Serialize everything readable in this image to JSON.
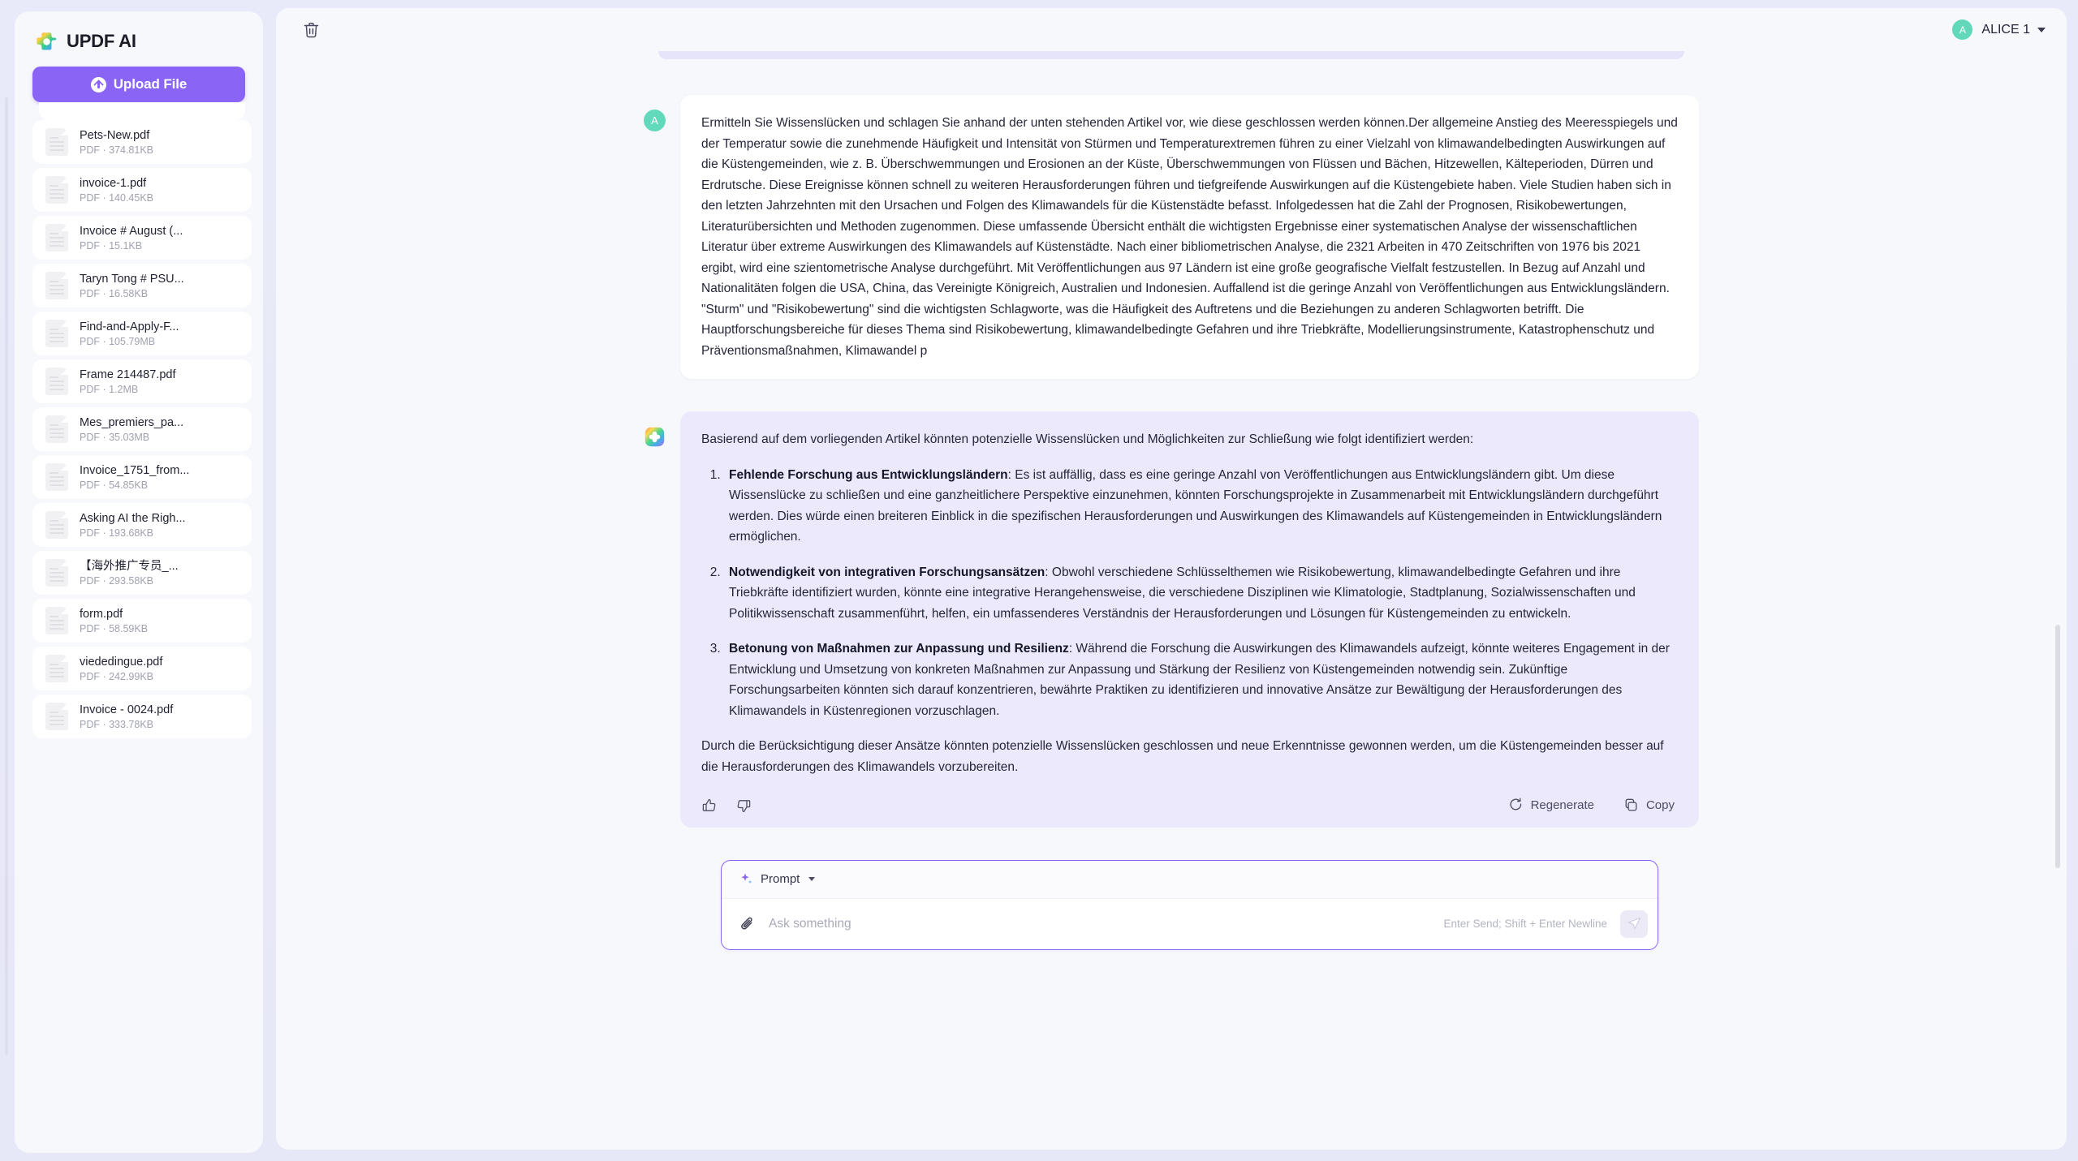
{
  "sidebar": {
    "brand": "UPDF AI",
    "upload_label": "Upload File",
    "files": [
      {
        "name": "Pets-New.pdf",
        "meta": "PDF · 374.81KB"
      },
      {
        "name": "invoice-1.pdf",
        "meta": "PDF · 140.45KB"
      },
      {
        "name": "Invoice # August (...",
        "meta": "PDF · 15.1KB"
      },
      {
        "name": "Taryn Tong # PSU...",
        "meta": "PDF · 16.58KB"
      },
      {
        "name": "Find-and-Apply-F...",
        "meta": "PDF · 105.79MB"
      },
      {
        "name": "Frame 214487.pdf",
        "meta": "PDF · 1.2MB"
      },
      {
        "name": "Mes_premiers_pa...",
        "meta": "PDF · 35.03MB"
      },
      {
        "name": "Invoice_1751_from...",
        "meta": "PDF · 54.85KB"
      },
      {
        "name": "Asking AI the Righ...",
        "meta": "PDF · 193.68KB"
      },
      {
        "name": "【海外推广专员_...",
        "meta": "PDF · 293.58KB"
      },
      {
        "name": "form.pdf",
        "meta": "PDF · 58.59KB"
      },
      {
        "name": "viededingue.pdf",
        "meta": "PDF · 242.99KB"
      },
      {
        "name": "Invoice - 0024.pdf",
        "meta": "PDF · 333.78KB"
      }
    ]
  },
  "topbar": {
    "delete_icon": "trash-icon",
    "user_name": "ALICE 1",
    "avatar_initial": "A"
  },
  "chat": {
    "user_message": {
      "avatar_initial": "A",
      "text": "Ermitteln Sie Wissenslücken und schlagen Sie anhand der unten stehenden Artikel vor, wie diese geschlossen werden können.Der allgemeine Anstieg des Meeresspiegels und der Temperatur sowie die zunehmende Häufigkeit und Intensität von Stürmen und Temperaturextremen führen zu einer Vielzahl von klimawandelbedingten Auswirkungen auf die Küstengemeinden, wie z. B. Überschwemmungen und Erosionen an der Küste, Überschwemmungen von Flüssen und Bächen, Hitzewellen, Kälteperioden, Dürren und Erdrutsche. Diese Ereignisse können schnell zu weiteren Herausforderungen führen und tiefgreifende Auswirkungen auf die Küstengebiete haben. Viele Studien haben sich in den letzten Jahrzehnten mit den Ursachen und Folgen des Klimawandels für die Küstenstädte befasst. Infolgedessen hat die Zahl der Prognosen, Risikobewertungen, Literaturübersichten und Methoden zugenommen. Diese umfassende Übersicht enthält die wichtigsten Ergebnisse einer systematischen Analyse der wissenschaftlichen Literatur über extreme Auswirkungen des Klimawandels auf Küstenstädte. Nach einer bibliometrischen Analyse, die 2321 Arbeiten in 470 Zeitschriften von 1976 bis 2021 ergibt, wird eine szientometrische Analyse durchgeführt. Mit Veröffentlichungen aus 97 Ländern ist eine große geografische Vielfalt festzustellen. In Bezug auf Anzahl und Nationalitäten folgen die USA, China, das Vereinigte Königreich, Australien und Indonesien. Auffallend ist die geringe Anzahl von Veröffentlichungen aus Entwicklungsländern. \"Sturm\" und \"Risikobewertung\" sind die wichtigsten Schlagworte, was die Häufigkeit des Auftretens und die Beziehungen zu anderen Schlagworten betrifft. Die Hauptforschungsbereiche für dieses Thema sind Risikobewertung, klimawandelbedingte Gefahren und ihre Triebkräfte, Modellierungsinstrumente, Katastrophenschutz und Präventionsmaßnahmen, Klimawandel p"
    },
    "ai_message": {
      "intro": "Basierend auf dem vorliegenden Artikel könnten potenzielle Wissenslücken und Möglichkeiten zur Schließung wie folgt identifiziert werden:",
      "items": [
        {
          "title": "Fehlende Forschung aus Entwicklungsländern",
          "body": ": Es ist auffällig, dass es eine geringe Anzahl von Veröffentlichungen aus Entwicklungsländern gibt. Um diese Wissenslücke zu schließen und eine ganzheitlichere Perspektive einzunehmen, könnten Forschungsprojekte in Zusammenarbeit mit Entwicklungsländern durchgeführt werden. Dies würde einen breiteren Einblick in die spezifischen Herausforderungen und Auswirkungen des Klimawandels auf Küstengemeinden in Entwicklungsländern ermöglichen."
        },
        {
          "title": "Notwendigkeit von integrativen Forschungsansätzen",
          "body": ": Obwohl verschiedene Schlüsselthemen wie Risikobewertung, klimawandelbedingte Gefahren und ihre Triebkräfte identifiziert wurden, könnte eine integrative Herangehensweise, die verschiedene Disziplinen wie Klimatologie, Stadtplanung, Sozialwissenschaften und Politikwissenschaft zusammenführt, helfen, ein umfassenderes Verständnis der Herausforderungen und Lösungen für Küstengemeinden zu entwickeln."
        },
        {
          "title": "Betonung von Maßnahmen zur Anpassung und Resilienz",
          "body": ": Während die Forschung die Auswirkungen des Klimawandels aufzeigt, könnte weiteres Engagement in der Entwicklung und Umsetzung von konkreten Maßnahmen zur Anpassung und Stärkung der Resilienz von Küstengemeinden notwendig sein. Zukünftige Forschungsarbeiten könnten sich darauf konzentrieren, bewährte Praktiken zu identifizieren und innovative Ansätze zur Bewältigung der Herausforderungen des Klimawandels in Küstenregionen vorzuschlagen."
        }
      ],
      "conclusion": "Durch die Berücksichtigung dieser Ansätze könnten potenzielle Wissenslücken geschlossen und neue Erkenntnisse gewonnen werden, um die Küstengemeinden besser auf die Herausforderungen des Klimawandels vorzubereiten.",
      "actions": {
        "thumbs_up": "thumbs-up-icon",
        "thumbs_down": "thumbs-down-icon",
        "regenerate": "Regenerate",
        "copy": "Copy"
      }
    }
  },
  "composer": {
    "prompt_label": "Prompt",
    "input_value": "",
    "input_placeholder": "Ask something",
    "hint": "Enter Send; Shift + Enter Newline"
  },
  "colors": {
    "accent": "#8a64f5",
    "ai_bubble": "#ebe9fb",
    "avatar_green": "#54d6b4",
    "page_bg": "#e8e9f8"
  }
}
